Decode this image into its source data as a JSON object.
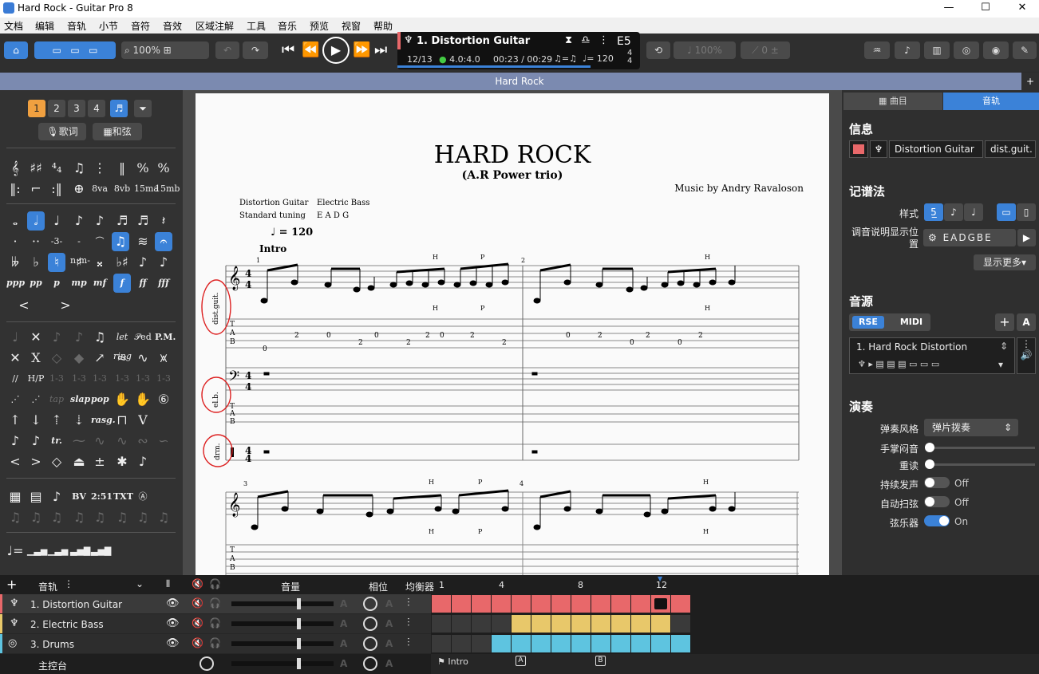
{
  "window": {
    "title": "Hard Rock - Guitar Pro 8",
    "minimize": "—",
    "maximize": "☐",
    "close": "✕"
  },
  "menu": [
    "文档",
    "编辑",
    "音轨",
    "小节",
    "音符",
    "音效",
    "区域注解",
    "工具",
    "音乐",
    "预览",
    "视窗",
    "帮助"
  ],
  "toolbar": {
    "zoom": "100%",
    "velocity": "100%",
    "tuning_value": "0"
  },
  "lcd": {
    "track": "1. Distortion Guitar",
    "key": "E5",
    "bar": "12/13",
    "signature": "4.0:4.0",
    "time": "00:23 / 00:29",
    "tempo": "♩= 120",
    "triplet": "♫=♫",
    "time_sig_top": "4",
    "time_sig_bottom": "4"
  },
  "doc_tab": "Hard Rock",
  "left": {
    "voices": [
      "1",
      "2",
      "3",
      "4"
    ],
    "lyrics": "歌词",
    "chords": "和弦"
  },
  "score": {
    "title": "HARD ROCK",
    "subtitle": "(A.R Power trio)",
    "music_by": "Music by Andry Ravaloson",
    "instr1": "Distortion Guitar",
    "tuning1": "Standard tuning",
    "instr2": "Electric Bass",
    "tuning2": "E A D G",
    "tempo": "♩ = 120",
    "section": "Intro",
    "labels": [
      "dist.guit.",
      "el.b.",
      "drm."
    ],
    "tab_numbers": [
      "0",
      "2",
      "0",
      "2",
      "0",
      "2",
      "2",
      "0",
      "2",
      "2",
      "0",
      "2",
      "0",
      "2",
      "0",
      "2"
    ],
    "H": "H",
    "P": "P",
    "bar1": "1",
    "bar2": "2",
    "bar3": "3",
    "bar4": "4"
  },
  "right": {
    "tab_song": "曲目",
    "tab_track": "音轨",
    "info": "信息",
    "track_name": "Distortion Guitar",
    "short_name": "dist.guit.",
    "notation": "记谱法",
    "style": "样式",
    "tuning_pos": "调音说明显示位置",
    "tuning": "EADGBE",
    "more": "显示更多",
    "sound": "音源",
    "rse": "RSE",
    "midi": "MIDI",
    "preset": "1. Hard Rock Distortion",
    "perform": "演奏",
    "strum_style": "弹奏风格",
    "strum_value": "弹片拨奏",
    "palm_mute": "手掌闷音",
    "accent": "重读",
    "sustain": "持续发声",
    "sustain_val": "Off",
    "auto_strum": "自动扫弦",
    "auto_strum_val": "Off",
    "string_inst": "弦乐器",
    "string_inst_val": "On"
  },
  "bottom": {
    "header_tracks": "音轨",
    "volume": "音量",
    "pan": "相位",
    "eq": "均衡器",
    "tracks": [
      {
        "name": "1. Distortion Guitar",
        "color": "#e8686a"
      },
      {
        "name": "2. Electric Bass",
        "color": "#e8c86a"
      },
      {
        "name": "3. Drums",
        "color": "#5ec4e0"
      }
    ],
    "master": "主控台",
    "bars": [
      "1",
      "4",
      "8",
      "12"
    ],
    "markers": [
      "Intro",
      "A",
      "B"
    ]
  }
}
